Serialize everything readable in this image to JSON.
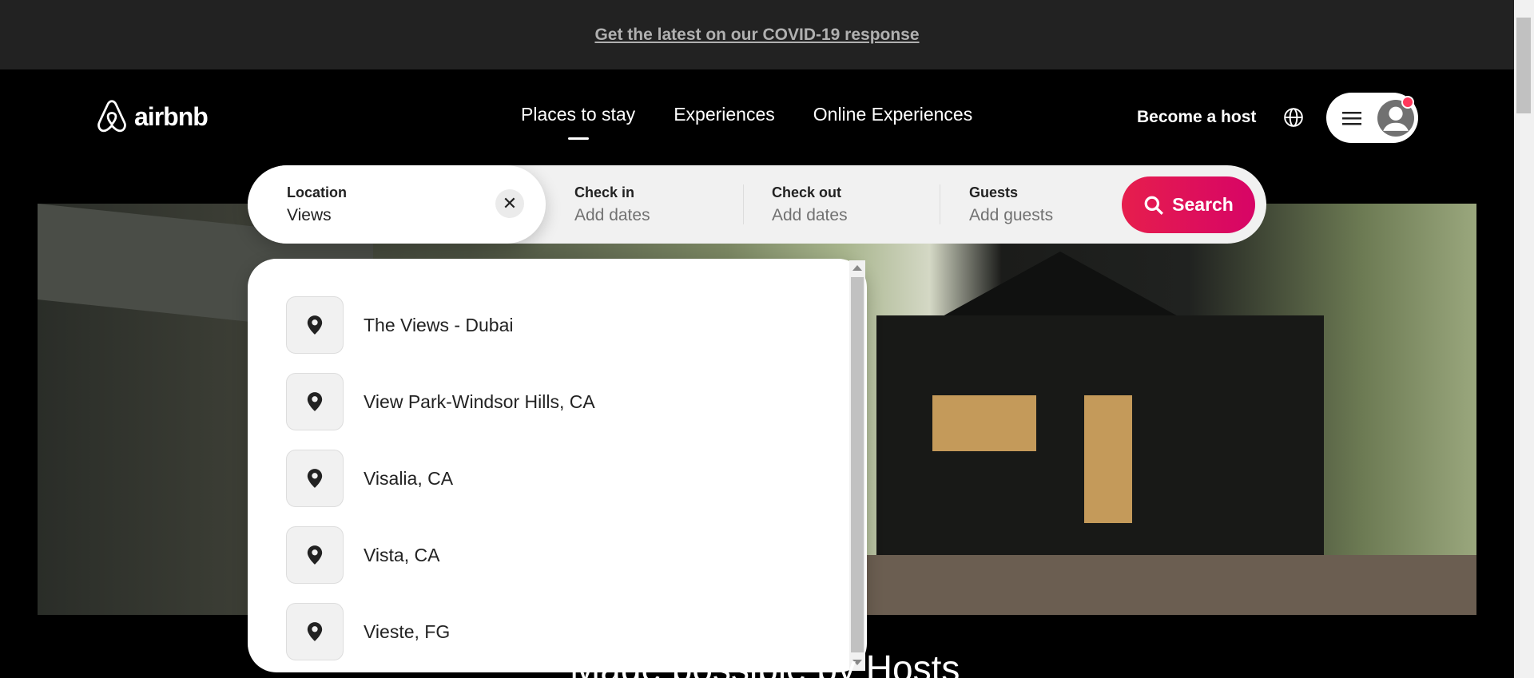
{
  "banner": {
    "text": "Get the latest on our COVID-19 response"
  },
  "header": {
    "logo_text": "airbnb",
    "nav": [
      {
        "label": "Places to stay",
        "active": true
      },
      {
        "label": "Experiences",
        "active": false
      },
      {
        "label": "Online Experiences",
        "active": false
      }
    ],
    "host_label": "Become a host"
  },
  "search": {
    "location_label": "Location",
    "location_value": "Views",
    "checkin_label": "Check in",
    "checkin_placeholder": "Add dates",
    "checkout_label": "Check out",
    "checkout_placeholder": "Add dates",
    "guests_label": "Guests",
    "guests_placeholder": "Add guests",
    "button_label": "Search",
    "accent_color": "#e61e4d"
  },
  "suggestions": [
    {
      "label": "The Views - Dubai",
      "icon": "map-pin-icon"
    },
    {
      "label": "View Park-Windsor Hills, CA",
      "icon": "map-pin-icon"
    },
    {
      "label": "Visalia, CA",
      "icon": "map-pin-icon"
    },
    {
      "label": "Vista, CA",
      "icon": "map-pin-icon"
    },
    {
      "label": "Vieste, FG",
      "icon": "map-pin-icon"
    }
  ],
  "hero": {
    "heading_partial": "Made possible by Hosts"
  }
}
